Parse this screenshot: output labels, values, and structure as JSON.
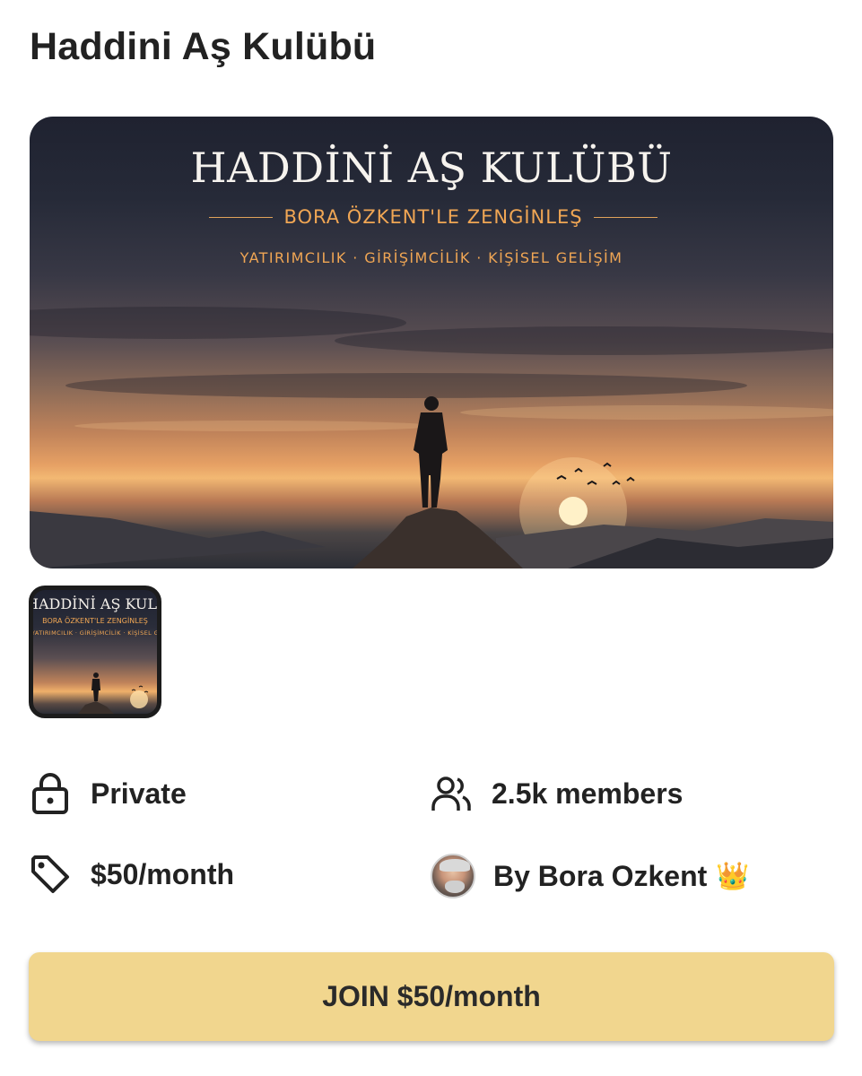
{
  "page": {
    "title": "Haddini Aş Kulübü"
  },
  "hero": {
    "heading": "HADDİNİ AŞ KULÜBÜ",
    "subheading": "BORA ÖZKENT'LE ZENGİNLEŞ",
    "tags": "YATIRIMCILIK · GİRİŞİMCİLİK · KİŞİSEL GELİŞİM"
  },
  "thumbnail": {
    "heading": "HADDİNİ AŞ KULÜBÜ",
    "subheading": "BORA ÖZKENT'LE ZENGİNLEŞ",
    "tags": "YATIRIMCILIK · GİRİŞİMCİLİK · KİŞİSEL GELİŞİM"
  },
  "info": {
    "privacy": "Private",
    "members": "2.5k members",
    "price": "$50/month",
    "owner": "By Bora Ozkent",
    "owner_badge": "👑"
  },
  "join": {
    "label": "JOIN $50/month"
  },
  "icons": {
    "privacy": "lock-icon",
    "members": "users-icon",
    "price": "tag-icon",
    "owner": "avatar"
  },
  "colors": {
    "join_button": "#f1d68e",
    "accent_orange": "#f0a654"
  }
}
